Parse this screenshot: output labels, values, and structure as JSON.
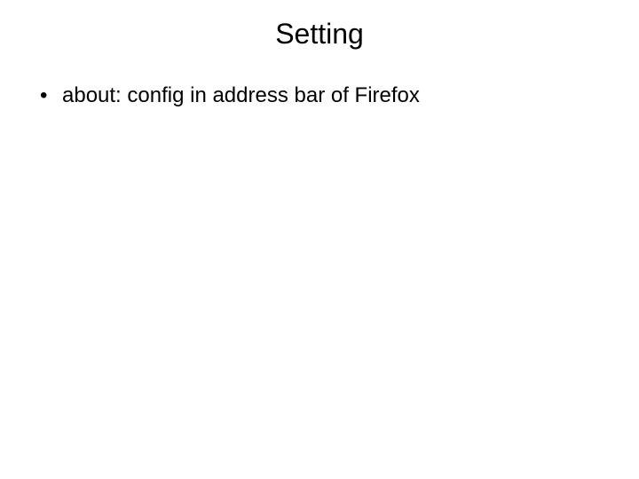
{
  "slide": {
    "title": "Setting",
    "bullets": [
      "about: config in address bar of Firefox"
    ]
  }
}
